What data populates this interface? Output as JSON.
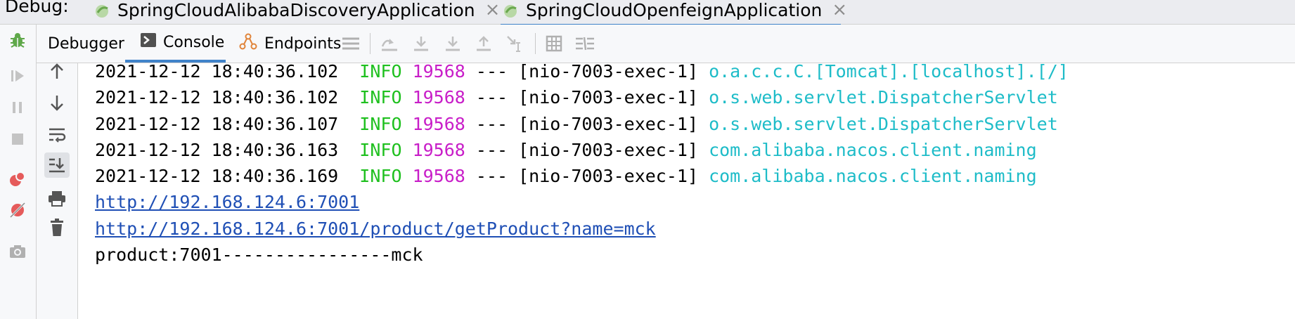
{
  "top_bar": {
    "label": "Debug:",
    "tabs": [
      {
        "title": "SpringCloudAlibabaDiscoveryApplication",
        "active": false
      },
      {
        "title": "SpringCloudOpenfeignApplication",
        "active": true
      }
    ],
    "close_glyph": "×"
  },
  "sub_toolbar": {
    "tabs": [
      {
        "label": "Debugger",
        "icon": "",
        "active": false
      },
      {
        "label": "Console",
        "icon": "console-icon",
        "active": true
      },
      {
        "label": "Endpoints",
        "icon": "endpoints-icon",
        "active": false
      }
    ]
  },
  "console": {
    "log_lines": [
      {
        "timestamp": "2021-12-12 18:40:36.102",
        "level": "INFO",
        "pid": "19568",
        "sep": "---",
        "thread": "[nio-7003-exec-1]",
        "logger": "o.a.c.c.C.[Tomcat].[localhost].[/]",
        "tail": ":"
      },
      {
        "timestamp": "2021-12-12 18:40:36.102",
        "level": "INFO",
        "pid": "19568",
        "sep": "---",
        "thread": "[nio-7003-exec-1]",
        "logger": "o.s.web.servlet.DispatcherServlet",
        "tail": ":"
      },
      {
        "timestamp": "2021-12-12 18:40:36.107",
        "level": "INFO",
        "pid": "19568",
        "sep": "---",
        "thread": "[nio-7003-exec-1]",
        "logger": "o.s.web.servlet.DispatcherServlet",
        "tail": ":"
      },
      {
        "timestamp": "2021-12-12 18:40:36.163",
        "level": "INFO",
        "pid": "19568",
        "sep": "---",
        "thread": "[nio-7003-exec-1]",
        "logger": "com.alibaba.nacos.client.naming",
        "tail": ":"
      },
      {
        "timestamp": "2021-12-12 18:40:36.169",
        "level": "INFO",
        "pid": "19568",
        "sep": "---",
        "thread": "[nio-7003-exec-1]",
        "logger": "com.alibaba.nacos.client.naming",
        "tail": ":"
      }
    ],
    "link1": "http://192.168.124.6:7001",
    "link2": "http://192.168.124.6:7001/product/getProduct?name=mck",
    "output": "product:7001----------------mck"
  },
  "colors": {
    "level": "#1fc01f",
    "pid": "#c81ec8",
    "logger": "#1ebcc8",
    "link": "#1f4fb5",
    "active_tab_underline": "#4083c9"
  }
}
